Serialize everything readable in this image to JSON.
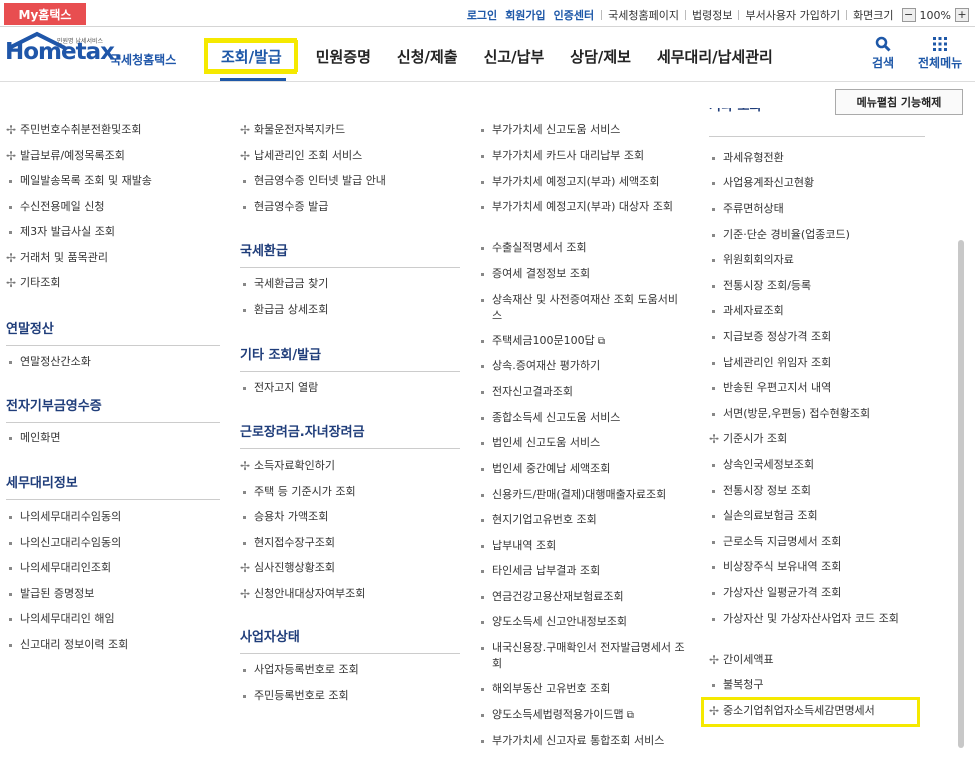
{
  "top_tab": "My홈택스",
  "top_links": {
    "login": "로그인",
    "join": "회원가입",
    "cert": "인증센터",
    "portal": "국세청홈페이지",
    "law": "법령정보",
    "dept": "부서사용자 가입하기",
    "screen": "화면크기",
    "zoom": "100%"
  },
  "logo": {
    "eng": "Hometax.",
    "kor": "국세청홈택스",
    "small": "민원명 납세서비스"
  },
  "gnb": [
    "조회/발급",
    "민원증명",
    "신청/제출",
    "신고/납부",
    "상담/제보",
    "세무대리/납세관리"
  ],
  "util": {
    "search": "검색",
    "all_menu": "전체메뉴"
  },
  "collapse_button": "메뉴펼침 기능해제",
  "col1": {
    "items_a": [
      {
        "m": "plus",
        "t": "주민번호수취분전환및조회"
      },
      {
        "m": "plus",
        "t": "발급보류/예정목록조회"
      },
      {
        "m": "dot",
        "t": "메일발송목록 조회 및 재발송"
      },
      {
        "m": "dot",
        "t": "수신전용메일 신청"
      },
      {
        "m": "dot",
        "t": "제3자 발급사실 조회"
      },
      {
        "m": "plus",
        "t": "거래처 및 품목관리"
      },
      {
        "m": "plus",
        "t": "기타조회"
      }
    ],
    "sec1": "연말정산",
    "items_b": [
      {
        "m": "dot",
        "t": "연말정산간소화"
      }
    ],
    "sec2": "전자기부금영수증",
    "items_c": [
      {
        "m": "dot",
        "t": "메인화면"
      }
    ],
    "sec3": "세무대리정보",
    "items_d": [
      {
        "m": "dot",
        "t": "나의세무대리수임동의"
      },
      {
        "m": "dot",
        "t": "나의신고대리수임동의"
      },
      {
        "m": "dot",
        "t": "나의세무대리인조회"
      },
      {
        "m": "dot",
        "t": "발급된 증명정보"
      },
      {
        "m": "dot",
        "t": "나의세무대리인 해임"
      },
      {
        "m": "dot",
        "t": "신고대리 정보이력 조회"
      }
    ]
  },
  "col2": {
    "items_a": [
      {
        "m": "plus",
        "t": "화물운전자복지카드"
      },
      {
        "m": "plus",
        "t": "납세관리인 조회 서비스"
      },
      {
        "m": "dot",
        "t": "현금영수증 인터넷 발급 안내"
      },
      {
        "m": "dot",
        "t": "현금영수증 발급"
      }
    ],
    "sec1": "국세환급",
    "items_b": [
      {
        "m": "dot",
        "t": "국세환급금 찾기"
      },
      {
        "m": "dot",
        "t": "환급금 상세조회"
      }
    ],
    "sec2": "기타 조회/발급",
    "items_c": [
      {
        "m": "dot",
        "t": "전자고지 열람"
      }
    ],
    "sec3": "근로장려금.자녀장려금",
    "items_d": [
      {
        "m": "plus",
        "t": "소득자료확인하기"
      },
      {
        "m": "dot",
        "t": "주택 등 기준시가 조회"
      },
      {
        "m": "dot",
        "t": "승용차 가액조회"
      },
      {
        "m": "dot",
        "t": "현지접수장구조회"
      },
      {
        "m": "plus",
        "t": "심사진행상황조회"
      },
      {
        "m": "plus",
        "t": "신청안내대상자여부조회"
      }
    ],
    "sec4": "사업자상태",
    "items_e": [
      {
        "m": "dot",
        "t": "사업자등록번호로 조회"
      },
      {
        "m": "dot",
        "t": "주민등록번호로 조회"
      }
    ]
  },
  "col3": {
    "items": [
      {
        "m": "dot",
        "t": "부가가치세 신고도움 서비스"
      },
      {
        "m": "dot",
        "t": "부가가치세 카드사 대리납부 조회"
      },
      {
        "m": "dot",
        "t": "부가가치세 예정고지(부과) 세액조회"
      },
      {
        "m": "dot",
        "t": "부가가치세 예정고지(부과) 대상자 조회"
      },
      {
        "m": "dot",
        "t": "수출실적명세서 조회"
      },
      {
        "m": "dot",
        "t": "증여세 결정정보 조회"
      },
      {
        "m": "dot",
        "t": "상속재산 및 사전증여재산 조회 도움서비스"
      },
      {
        "m": "dot",
        "t": "주택세금100문100답",
        "ext": true
      },
      {
        "m": "dot",
        "t": "상속.증여재산 평가하기"
      },
      {
        "m": "dot",
        "t": "전자신고결과조회"
      },
      {
        "m": "dot",
        "t": "종합소득세 신고도움 서비스"
      },
      {
        "m": "dot",
        "t": "법인세 신고도움 서비스"
      },
      {
        "m": "dot",
        "t": "법인세 중간예납 세액조회"
      },
      {
        "m": "dot",
        "t": "신용카드/판매(결제)대행매출자료조회"
      },
      {
        "m": "dot",
        "t": "현지기업고유번호 조회"
      },
      {
        "m": "dot",
        "t": "납부내역 조회"
      },
      {
        "m": "dot",
        "t": "타인세금 납부결과 조회"
      },
      {
        "m": "dot",
        "t": "연금건강고용산재보험료조회"
      },
      {
        "m": "dot",
        "t": "양도소득세 신고안내정보조회"
      },
      {
        "m": "dot",
        "t": "내국신용장.구매확인서 전자발급명세서 조회"
      },
      {
        "m": "dot",
        "t": "해외부동산 고유번호 조회"
      },
      {
        "m": "dot",
        "t": "양도소득세법령적용가이드맵",
        "ext": true
      },
      {
        "m": "dot",
        "t": "부가가치세 신고자료 통합조회 서비스"
      }
    ]
  },
  "col4": {
    "sec_partial": "기타 조회",
    "items": [
      {
        "m": "dot",
        "t": "과세유형전환"
      },
      {
        "m": "dot",
        "t": "사업용계좌신고현황"
      },
      {
        "m": "dot",
        "t": "주류면허상태"
      },
      {
        "m": "dot",
        "t": "기준·단순 경비율(업종코드)"
      },
      {
        "m": "dot",
        "t": "위원회회의자료"
      },
      {
        "m": "dot",
        "t": "전통시장 조회/등록"
      },
      {
        "m": "dot",
        "t": "과세자료조회"
      },
      {
        "m": "dot",
        "t": "지급보증 정상가격 조회"
      },
      {
        "m": "dot",
        "t": "납세관리인 위임자 조회"
      },
      {
        "m": "dot",
        "t": "반송된 우편고지서 내역"
      },
      {
        "m": "dot",
        "t": "서면(방문,우편등) 접수현황조회"
      },
      {
        "m": "plus",
        "t": "기준시가 조회"
      },
      {
        "m": "dot",
        "t": "상속인국세정보조회"
      },
      {
        "m": "dot",
        "t": "전통시장 정보 조회"
      },
      {
        "m": "dot",
        "t": "실손의료보험금 조회"
      },
      {
        "m": "dot",
        "t": "근로소득 지급명세서 조회"
      },
      {
        "m": "dot",
        "t": "비상장주식 보유내역 조회"
      },
      {
        "m": "dot",
        "t": "가상자산 일평균가격 조회"
      },
      {
        "m": "dot",
        "t": "가상자산 및 가상자산사업자 코드 조회"
      },
      {
        "m": "plus",
        "t": "간이세액표"
      },
      {
        "m": "dot",
        "t": "불복청구"
      },
      {
        "m": "plus",
        "t": "중소기업취업자소득세감면명세서"
      }
    ]
  }
}
